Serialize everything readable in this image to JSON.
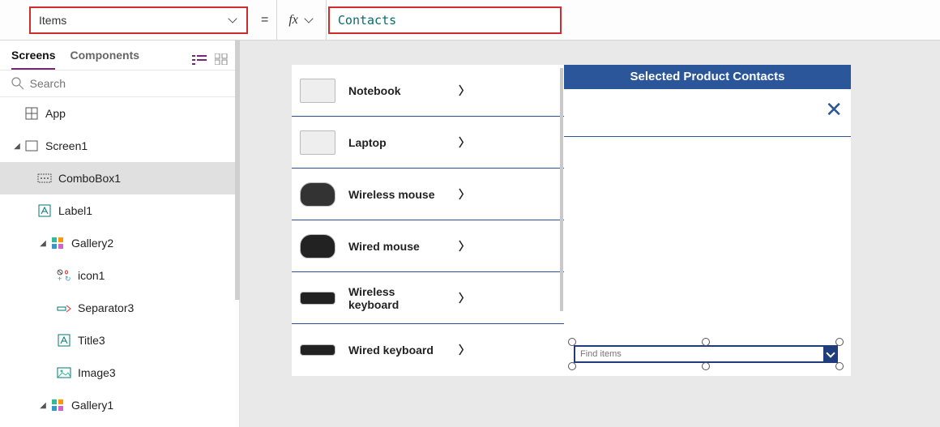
{
  "property": {
    "name": "Items",
    "formula": "Contacts"
  },
  "eq_symbol": "=",
  "fx_label": "fx",
  "tabs": {
    "screens": "Screens",
    "components": "Components"
  },
  "search": {
    "placeholder": "Search"
  },
  "tree": {
    "app": "App",
    "screen1": "Screen1",
    "combobox1": "ComboBox1",
    "label1": "Label1",
    "gallery2": "Gallery2",
    "icon1": "icon1",
    "separator3": "Separator3",
    "title3": "Title3",
    "image3": "Image3",
    "gallery1": "Gallery1"
  },
  "canvas": {
    "header_title": "Selected Product Contacts",
    "combo_placeholder": "Find items",
    "gallery_items": [
      {
        "label": "Notebook"
      },
      {
        "label": "Laptop"
      },
      {
        "label": "Wireless mouse"
      },
      {
        "label": "Wired mouse"
      },
      {
        "label": "Wireless keyboard"
      },
      {
        "label": "Wired keyboard"
      }
    ]
  }
}
